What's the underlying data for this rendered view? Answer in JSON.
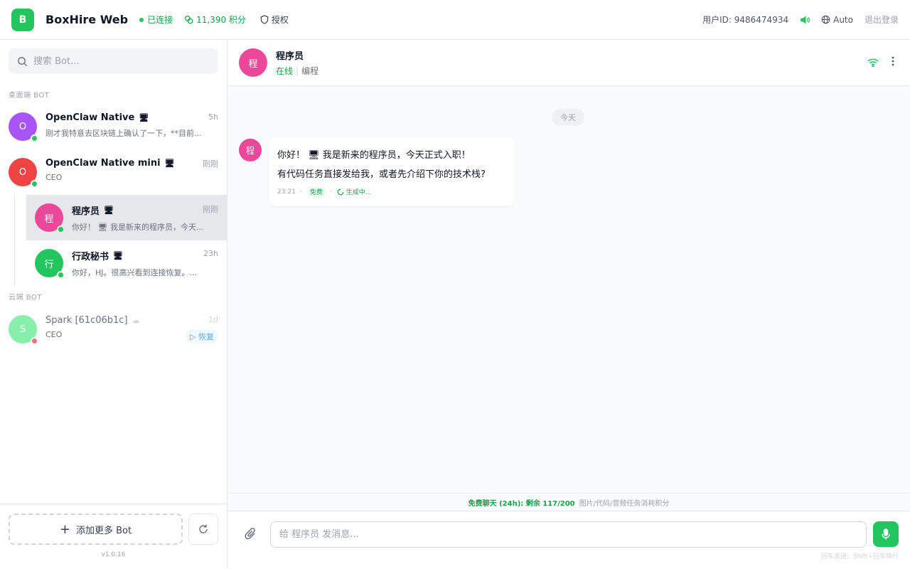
{
  "app": {
    "logo_letter": "B",
    "title": "BoxHire Web",
    "status": "已连接",
    "points": "11,390 积分",
    "auth": "授权",
    "user_id": "用户ID: 9486474934",
    "language": "Auto",
    "logout": "退出登录"
  },
  "sidebar": {
    "search_placeholder": "搜索 Bot...",
    "desktop_section": "桌面端 BOT",
    "cloud_section": "云端 BOT",
    "bots": [
      {
        "initial": "O",
        "name": "OpenClaw Native",
        "icon": "🖥",
        "time": "5h",
        "preview": "刚才我特意去区块链上确认了一下，**目前...",
        "avatar_color": "#a855f7",
        "presence_color": "#22c55e"
      },
      {
        "initial": "O",
        "name": "OpenClaw Native mini",
        "icon": "🖥",
        "time": "刚刚",
        "preview": "CEO",
        "avatar_color": "#ef4444",
        "presence_color": "#22c55e"
      },
      {
        "initial": "程",
        "name": "程序员",
        "icon": "🖥",
        "time": "刚刚",
        "preview": "你好！ 🖥 我是新来的程序员，今天...",
        "avatar_color": "#ec4899",
        "presence_color": "#22c55e"
      },
      {
        "initial": "行",
        "name": "行政秘书",
        "icon": "🖥",
        "time": "23h",
        "preview": "你好，HJ。很高兴看到连接恢复。...",
        "avatar_color": "#22c55e",
        "presence_color": "#22c55e"
      }
    ],
    "cloud_bots": [
      {
        "initial": "S",
        "name": "Spark [61c06b1c]",
        "icon": "☁",
        "time": "1d",
        "preview": "CEO",
        "restore": "▷ 恢复",
        "avatar_color": "#86efac",
        "presence_color": "#f87171"
      }
    ],
    "add_bot": "添加更多 Bot",
    "version": "v1.0.16"
  },
  "chat": {
    "avatar_initial": "程",
    "name": "程序员",
    "online": "在线",
    "tag": "编程",
    "date_divider": "今天",
    "message": {
      "line1": "你好！ 🖥 我是新来的程序员，今天正式入职！",
      "line2": "有代码任务直接发给我，或者先介绍下你的技术栈?",
      "time": "23:21",
      "free_badge": "免费",
      "status": "生成中..."
    },
    "quota_main": "免费聊天 (24h): 剩余 117/200",
    "quota_sub": "图片/代码/音频任务消耗积分",
    "input_placeholder": "给 程序员 发消息...",
    "hint": "回车发送，Shift+回车换行"
  },
  "colors": {
    "accent": "#22c55e",
    "accent_dark": "#16a34a"
  }
}
